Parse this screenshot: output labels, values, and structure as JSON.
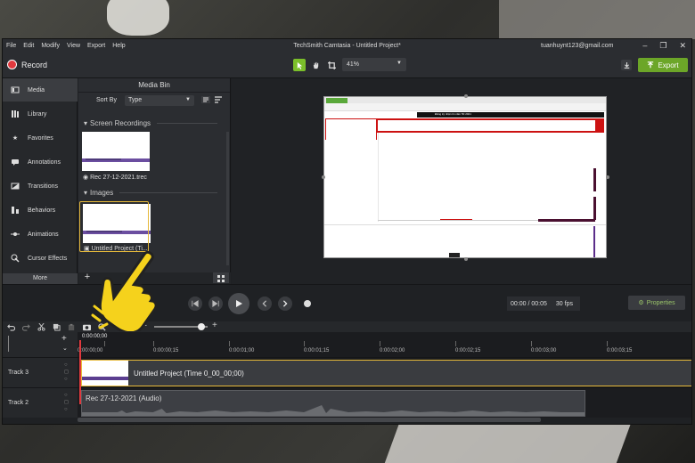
{
  "window": {
    "title": "TechSmith Camtasia - Untitled Project*",
    "account": "tuanhuynt123@gmail.com",
    "menu": [
      "File",
      "Edit",
      "Modify",
      "View",
      "Export",
      "Help"
    ]
  },
  "toolbar": {
    "record_label": "Record",
    "zoom_value": "41%",
    "export_label": "Export"
  },
  "sidebar": {
    "items": [
      {
        "label": "Media",
        "icon": "film-icon"
      },
      {
        "label": "Library",
        "icon": "library-icon"
      },
      {
        "label": "Favorites",
        "icon": "star-icon"
      },
      {
        "label": "Annotations",
        "icon": "annotation-icon"
      },
      {
        "label": "Transitions",
        "icon": "transition-icon"
      },
      {
        "label": "Behaviors",
        "icon": "behavior-icon"
      },
      {
        "label": "Animations",
        "icon": "animation-icon"
      },
      {
        "label": "Cursor Effects",
        "icon": "cursor-icon"
      }
    ],
    "more_label": "More"
  },
  "media_bin": {
    "title": "Media Bin",
    "sort_label": "Sort By",
    "sort_value": "Type",
    "sections": [
      {
        "title": "Screen Recordings",
        "item_label": "Rec 27-12-2021.trec"
      },
      {
        "title": "Images",
        "item_label": "Untitled Project (Ti..."
      }
    ]
  },
  "preview": {
    "banner_text": "Đăng ký nhận tin năm 50 2021"
  },
  "playback": {
    "time_current": "00:00",
    "time_total": "00:05",
    "fps": "30 fps",
    "properties_label": "Properties"
  },
  "timeline": {
    "playhead_time": "0:00:00;00",
    "ruler_ticks": [
      "0:00:00;00",
      "0:00:00;15",
      "0:00:01;00",
      "0:00:01;15",
      "0:00:02;00",
      "0:00:02;15",
      "0:00:03;00",
      "0:00:03;15"
    ],
    "tracks": [
      {
        "name": "Track 3",
        "clip_label": "Untitled Project (Time 0_00_00;00)"
      },
      {
        "name": "Track 2",
        "clip_label": "Rec 27-12-2021 (Audio)"
      }
    ]
  },
  "colors": {
    "accent_green": "#6ca628",
    "record_red": "#e0393e",
    "selection_yellow": "#e6b93a"
  }
}
